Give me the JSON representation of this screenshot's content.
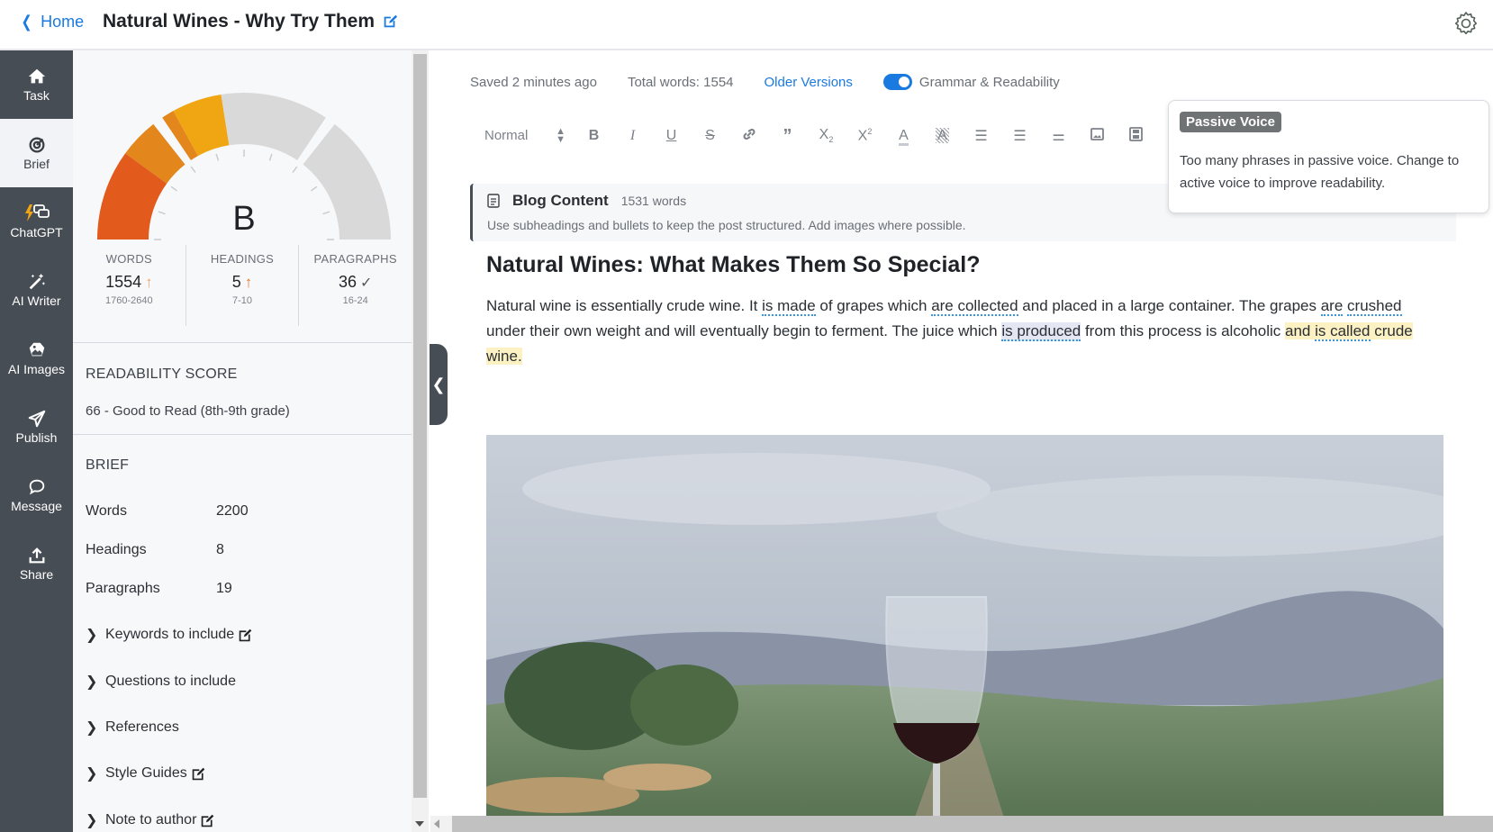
{
  "header": {
    "back_label": "Home",
    "title": "Natural Wines - Why Try Them"
  },
  "nav": {
    "items": [
      {
        "label": "Task",
        "icon": "home-icon",
        "active": false
      },
      {
        "label": "Brief",
        "icon": "target-icon",
        "active": true
      },
      {
        "label": "ChatGPT",
        "icon": "chat-bolt-icon",
        "active": false
      },
      {
        "label": "AI Writer",
        "icon": "magic-wand-icon",
        "active": false
      },
      {
        "label": "AI Images",
        "icon": "image-icon",
        "active": false
      },
      {
        "label": "Publish",
        "icon": "paper-plane-icon",
        "active": false
      },
      {
        "label": "Message",
        "icon": "message-icon",
        "active": false
      },
      {
        "label": "Share",
        "icon": "share-icon",
        "active": false
      }
    ]
  },
  "brief_panel": {
    "grade": "B",
    "gauge": {
      "filled_fraction": 0.45,
      "colors": {
        "red": "#e25a1c",
        "orange": "#e3861b",
        "yellow": "#f0a612",
        "empty": "#d9d9d9"
      }
    },
    "stats": [
      {
        "label": "WORDS",
        "value": "1554",
        "indicator": "↑",
        "range": "1760-2640"
      },
      {
        "label": "HEADINGS",
        "value": "5",
        "indicator": "↑",
        "range": "7-10"
      },
      {
        "label": "PARAGRAPHS",
        "value": "36",
        "indicator": "✓",
        "range": "16-24"
      }
    ],
    "readability": {
      "title": "READABILITY SCORE",
      "value": "66 - Good to Read (8th-9th grade)"
    },
    "brief": {
      "title": "BRIEF",
      "rows": [
        {
          "label": "Words",
          "value": "2200"
        },
        {
          "label": "Headings",
          "value": "8"
        },
        {
          "label": "Paragraphs",
          "value": "19"
        }
      ],
      "sections": [
        {
          "label": "Keywords to include",
          "editable": true
        },
        {
          "label": "Questions to include",
          "editable": false
        },
        {
          "label": "References",
          "editable": false
        },
        {
          "label": "Style Guides",
          "editable": true
        },
        {
          "label": "Note to author",
          "editable": true
        }
      ]
    }
  },
  "editor": {
    "saved_status": "Saved 2 minutes ago",
    "total_words": "Total words: 1554",
    "older_versions": "Older Versions",
    "grammar_toggle": {
      "label": "Grammar & Readability",
      "on": true
    },
    "toolbar": {
      "format_select": "Normal",
      "buttons": [
        "bold",
        "italic",
        "underline",
        "strikethrough",
        "link",
        "blockquote",
        "subscript",
        "superscript",
        "text-color",
        "highlight",
        "ordered-list",
        "bullet-list",
        "align",
        "image",
        "video"
      ]
    },
    "section": {
      "title": "Blog Content",
      "word_count": "1531 words",
      "hint": "Use subheadings and bullets to keep the post structured. Add images where possible."
    },
    "heading": "Natural Wines: What Makes Them So Special?",
    "paragraph": {
      "s1": "Natural wine is essentially crude wine. It ",
      "pv1": "is made",
      "s2": " of grapes which ",
      "pv2": "are collected",
      "s3": " and placed in a large container. The grapes ",
      "pv3a": "are",
      "pv3b": "crushed",
      "s4": " under their own weight and will eventually begin to ferment. The juice which ",
      "pv4": "is produced",
      "s5": " from this process is alcoholic ",
      "hl1": "and ",
      "pv5": "is called",
      "hl2": " crude wine."
    }
  },
  "tooltip": {
    "badge": "Passive Voice",
    "text": "Too many phrases in passive voice. Change to active voice to improve readability."
  }
}
